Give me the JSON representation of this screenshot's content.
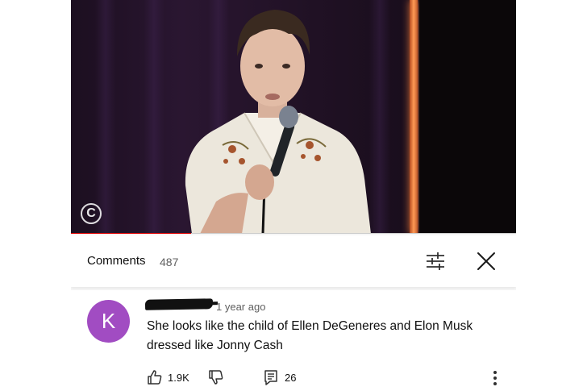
{
  "video": {
    "progress_fraction": 0.27,
    "logo_symbol": "C",
    "colors": {
      "progress": "#e00000",
      "neon": "#ff9a55"
    }
  },
  "comments_header": {
    "title": "Comments",
    "count": "487",
    "filter_icon": "filter-sliders-icon",
    "close_icon": "close-icon"
  },
  "comment": {
    "avatar_letter": "K",
    "avatar_color": "#a14cc2",
    "timestamp": "1 year ago",
    "text_line1": "She looks like the child of Ellen DeGeneres and Elon Musk",
    "text_line2": "dressed like Jonny Cash",
    "likes": "1.9K",
    "replies": "26",
    "icons": {
      "like": "thumbs-up-icon",
      "dislike": "thumbs-down-icon",
      "reply": "reply-icon",
      "more": "more-vertical-icon"
    }
  }
}
